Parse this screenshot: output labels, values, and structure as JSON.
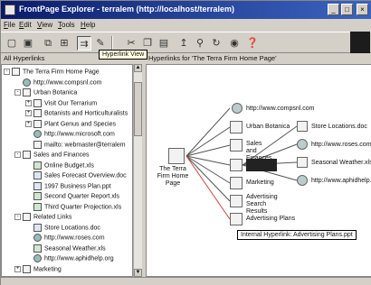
{
  "window": {
    "title": "FrontPage Explorer - terralem (http://localhost/terralem)",
    "minimize": "_",
    "maximize": "□",
    "close": "×"
  },
  "menu": [
    "File",
    "Edit",
    "View",
    "Tools",
    "Help"
  ],
  "tooltip": "Hyperlink View",
  "left_pane": {
    "header": "All Hyperlinks",
    "tree": [
      {
        "label": "The Terra Firm Home Page",
        "icon": "page-icon",
        "expander": "-"
      },
      {
        "label": "http://www.compsnl.com",
        "icon": "globe-icon",
        "expander": ""
      },
      {
        "label": "Urban Botanica",
        "icon": "page-icon",
        "expander": "-"
      },
      {
        "label": "Visit Our Terrarium",
        "icon": "page-icon",
        "expander": "+"
      },
      {
        "label": "Botanists and Horticulturalists",
        "icon": "page-icon",
        "expander": "+"
      },
      {
        "label": "Plant Genus and Species",
        "icon": "page-icon",
        "expander": "+"
      },
      {
        "label": "http://www.microsoft.com",
        "icon": "globe-icon",
        "expander": ""
      },
      {
        "label": "mailto: webmaster@terralem",
        "icon": "mail-icon",
        "expander": ""
      },
      {
        "label": "Sales and Finances",
        "icon": "page-icon",
        "expander": "-"
      },
      {
        "label": "Online Budget.xls",
        "icon": "spreadsheet-icon",
        "expander": ""
      },
      {
        "label": "Sales Forecast Overview.doc",
        "icon": "document-icon",
        "expander": ""
      },
      {
        "label": "1997 Business Plan.ppt",
        "icon": "presentation-icon",
        "expander": ""
      },
      {
        "label": "Second Quarter Report.xls",
        "icon": "spreadsheet-icon",
        "expander": ""
      },
      {
        "label": "Third Quarter Projection.xls",
        "icon": "spreadsheet-icon",
        "expander": ""
      },
      {
        "label": "Related Links",
        "icon": "page-icon",
        "expander": "-"
      },
      {
        "label": "Store Locations.doc",
        "icon": "document-icon",
        "expander": ""
      },
      {
        "label": "http://www.roses.com",
        "icon": "globe-icon",
        "expander": ""
      },
      {
        "label": "Seasonal Weather.xls",
        "icon": "spreadsheet-icon",
        "expander": ""
      },
      {
        "label": "http://www.aphidhelp.org",
        "icon": "globe-icon",
        "expander": ""
      },
      {
        "label": "Marketing",
        "icon": "page-icon",
        "expander": "+"
      }
    ]
  },
  "right_pane": {
    "header": "Hyperlinks for 'The Terra Firm Home Page'",
    "center_node": "The Terra Firm Home Page",
    "children": [
      "http://www.compsnl.com",
      "Urban Botanica",
      "Sales and Finances",
      "",
      "Marketing",
      "Advertising Search Results",
      "Advertising Plans"
    ],
    "grandchildren": [
      "Store Locations.doc",
      "http://www.roses.com",
      "Seasonal Weather.xls",
      "http://www.aphidhelp.org"
    ],
    "hover_label": "Internal Hyperlink: Advertising Plans.ppt"
  },
  "colors": {
    "title_gradient_start": "#0a1a6a",
    "title_gradient_end": "#3a64c0",
    "hover_line": "#d04040",
    "links": "#555555"
  }
}
